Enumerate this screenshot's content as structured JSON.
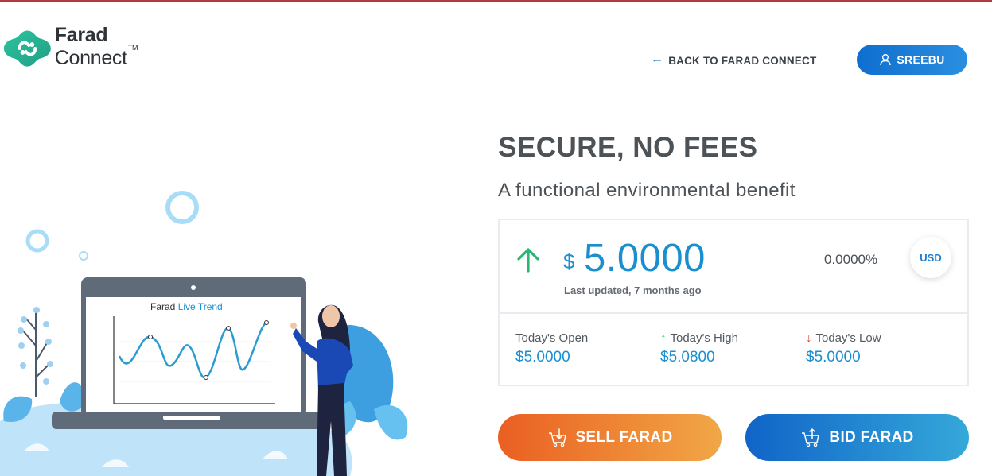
{
  "brand": {
    "name_bold": "Farad",
    "name_light": " Connect",
    "trademark": "TM",
    "logo_icon": "farad-logo-icon"
  },
  "header": {
    "back_link": "BACK TO FARAD CONNECT",
    "back_icon": "arrow-left-icon",
    "user_name": "SREEBU",
    "user_icon": "user-icon"
  },
  "illustration": {
    "chart_title_dark": "Farad ",
    "chart_title_accent": "Live Trend"
  },
  "hero": {
    "headline": "SECURE, NO FEES",
    "subheadline": "A functional environmental benefit"
  },
  "price": {
    "currency_symbol": "$",
    "value": "5.0000",
    "updated": "Last updated, 7 months ago",
    "change_pct": "0.0000%",
    "currency": "USD",
    "trend": "up",
    "accent_color": "#1a8fcf"
  },
  "stats": [
    {
      "label": "Today's Open",
      "value": "$5.0000",
      "icon": ""
    },
    {
      "label": "Today's High",
      "value": "$5.0800",
      "icon": "arrow-up-icon",
      "icon_color": "#2bb673"
    },
    {
      "label": "Today's Low",
      "value": "$5.0000",
      "icon": "arrow-down-icon",
      "icon_color": "#e03c31"
    }
  ],
  "actions": {
    "sell_label": "SELL FARAD",
    "bid_label": "BID FARAD",
    "sell_colors": [
      "#ea5f22",
      "#f1a746"
    ],
    "bid_colors": [
      "#1064c8",
      "#35a8d9"
    ]
  }
}
